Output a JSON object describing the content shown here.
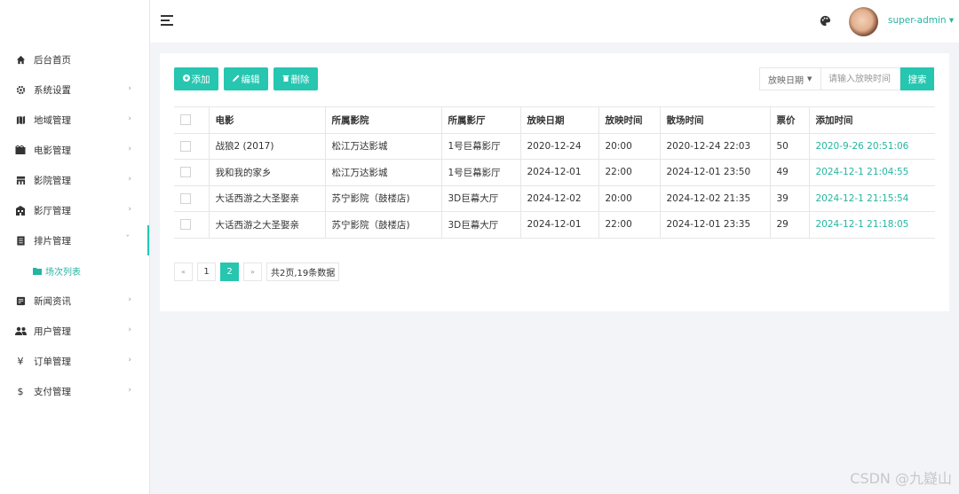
{
  "header": {
    "username": "super-admin ▾"
  },
  "sidebar": {
    "items": [
      {
        "name": "home",
        "label": "后台首页",
        "icon": "home-icon",
        "arrow": ""
      },
      {
        "name": "settings",
        "label": "系统设置",
        "icon": "gear-icon",
        "arrow": "›"
      },
      {
        "name": "region",
        "label": "地域管理",
        "icon": "map-icon",
        "arrow": "›"
      },
      {
        "name": "movie",
        "label": "电影管理",
        "icon": "film-icon",
        "arrow": "›"
      },
      {
        "name": "cinema",
        "label": "影院管理",
        "icon": "cinema-icon",
        "arrow": "›"
      },
      {
        "name": "hall",
        "label": "影厅管理",
        "icon": "hall-icon",
        "arrow": "›"
      },
      {
        "name": "schedule",
        "label": "排片管理",
        "icon": "schedule-icon",
        "arrow": "ˇ"
      },
      {
        "name": "news",
        "label": "新闻资讯",
        "icon": "news-icon",
        "arrow": "›"
      },
      {
        "name": "users",
        "label": "用户管理",
        "icon": "users-icon",
        "arrow": "›"
      },
      {
        "name": "orders",
        "label": "订单管理",
        "icon": "yen-icon",
        "arrow": "›"
      },
      {
        "name": "payment",
        "label": "支付管理",
        "icon": "dollar-icon",
        "arrow": "›"
      }
    ],
    "submenu": {
      "label": "场次列表"
    }
  },
  "toolbar": {
    "add_label": "添加",
    "edit_label": "编辑",
    "delete_label": "删除",
    "date_select": "放映日期",
    "search_placeholder": "请输入放映时间",
    "search_label": "搜索"
  },
  "table": {
    "headers": [
      "电影",
      "所属影院",
      "所属影厅",
      "放映日期",
      "放映时间",
      "散场时间",
      "票价",
      "添加时间"
    ],
    "rows": [
      [
        "战狼2 (2017)",
        "松江万达影城",
        "1号巨幕影厅",
        "2020-12-24",
        "20:00",
        "2020-12-24 22:03",
        "50",
        "2020-9-26 20:51:06"
      ],
      [
        "我和我的家乡",
        "松江万达影城",
        "1号巨幕影厅",
        "2024-12-01",
        "22:00",
        "2024-12-01 23:50",
        "49",
        "2024-12-1 21:04:55"
      ],
      [
        "大话西游之大圣娶亲",
        "苏宁影院（鼓楼店)",
        "3D巨幕大厅",
        "2024-12-02",
        "20:00",
        "2024-12-02 21:35",
        "39",
        "2024-12-1 21:15:54"
      ],
      [
        "大话西游之大圣娶亲",
        "苏宁影院（鼓楼店)",
        "3D巨幕大厅",
        "2024-12-01",
        "22:00",
        "2024-12-01 23:35",
        "29",
        "2024-12-1 21:18:05"
      ]
    ]
  },
  "pager": {
    "prev": "«",
    "pages": [
      "1",
      "2"
    ],
    "current": "2",
    "next": "»",
    "info": "共2页,19条数据"
  },
  "watermark": "CSDN @九嶷山",
  "colors": {
    "accent": "#26c6b0"
  }
}
